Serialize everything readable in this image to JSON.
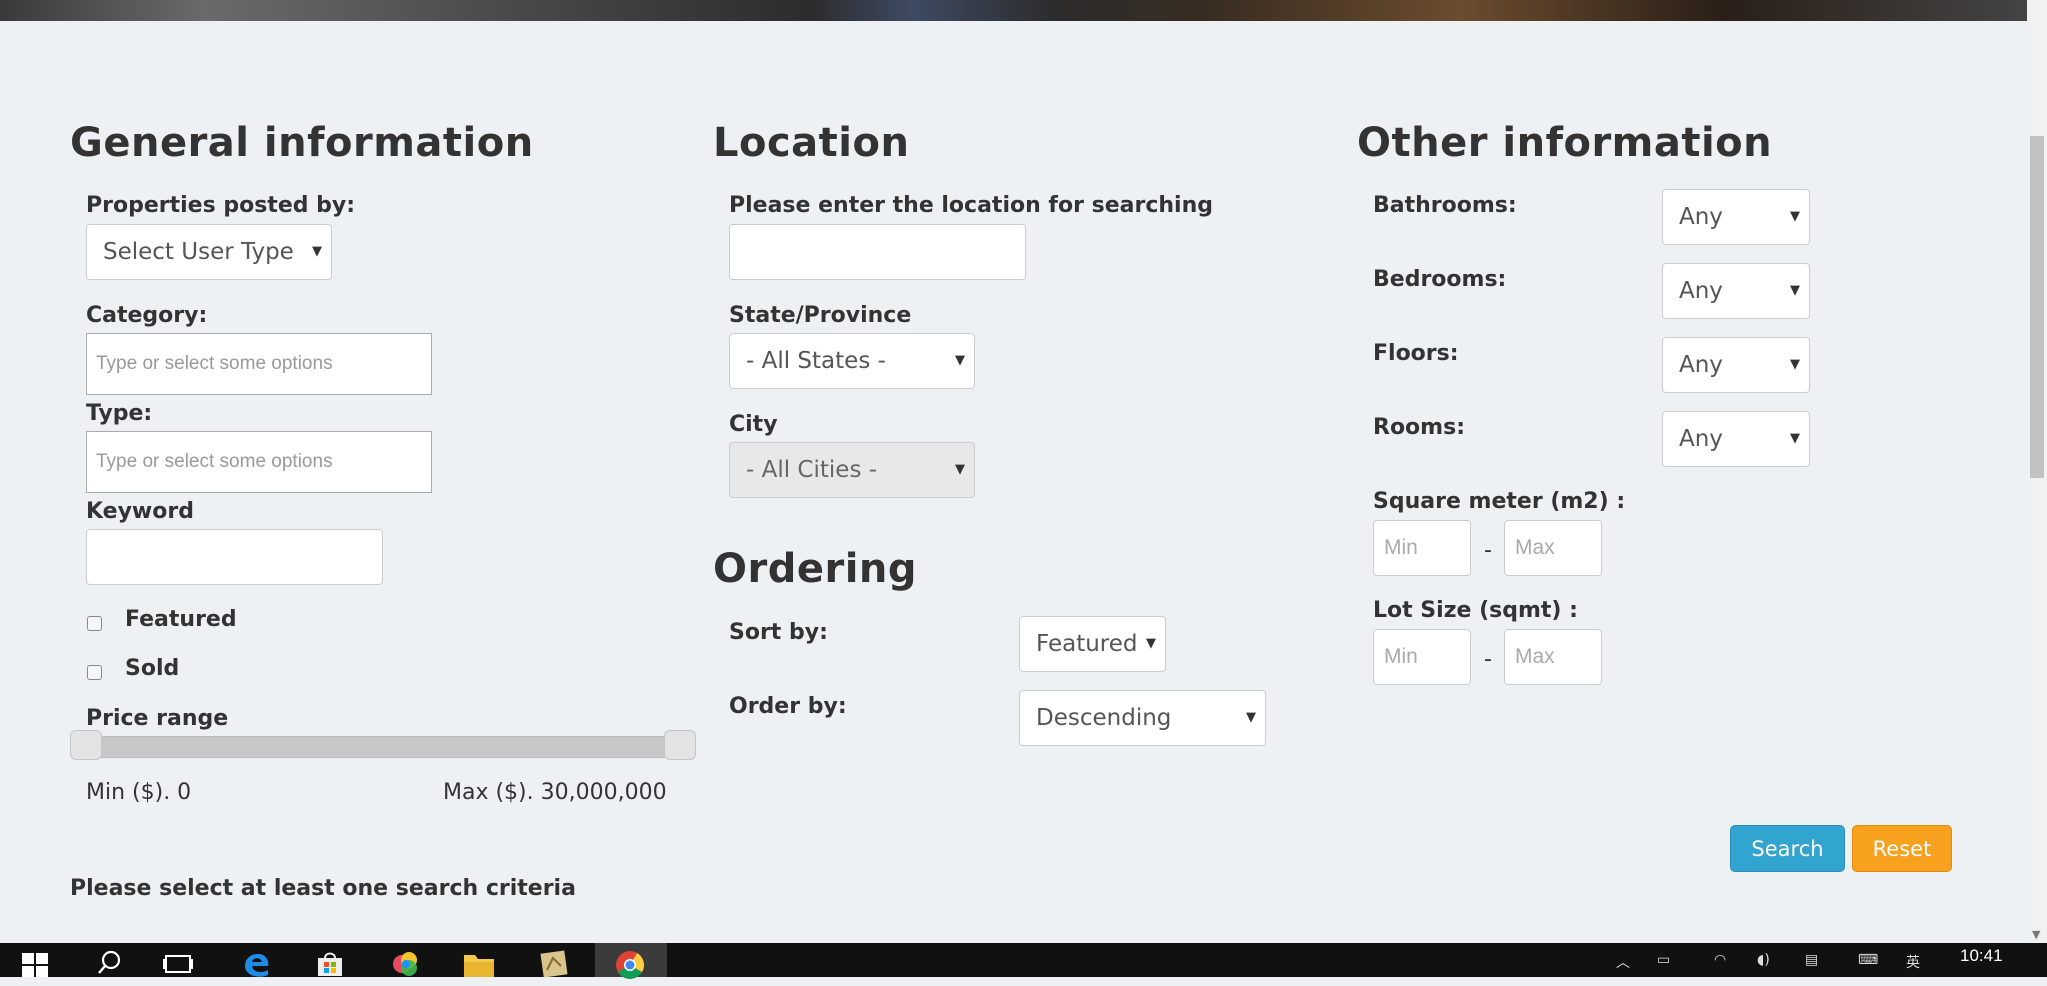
{
  "general": {
    "heading": "General information",
    "posted_by_label": "Properties posted by:",
    "posted_by_value": "Select User Type",
    "category_label": "Category:",
    "category_placeholder": "Type or select some options",
    "type_label": "Type:",
    "type_placeholder": "Type or select some options",
    "keyword_label": "Keyword",
    "keyword_value": "",
    "featured_label": "Featured",
    "sold_label": "Sold",
    "price_label": "Price range",
    "price_min": "Min ($). 0",
    "price_max": "Max ($). 30,000,000"
  },
  "location": {
    "heading": "Location",
    "prompt": "Please enter the location for searching",
    "location_value": "",
    "state_label": "State/Province",
    "state_value": "- All States -",
    "city_label": "City",
    "city_value": "- All Cities -"
  },
  "ordering": {
    "heading": "Ordering",
    "sort_label": "Sort by:",
    "sort_value": "Featured",
    "order_label": "Order by:",
    "order_value": "Descending"
  },
  "other": {
    "heading": "Other information",
    "bathrooms_label": "Bathrooms:",
    "bathrooms_value": "Any",
    "bedrooms_label": "Bedrooms:",
    "bedrooms_value": "Any",
    "floors_label": "Floors:",
    "floors_value": "Any",
    "rooms_label": "Rooms:",
    "rooms_value": "Any",
    "sqm_label": "Square meter (m2) :",
    "sqm_min_placeholder": "Min",
    "sqm_max_placeholder": "Max",
    "lot_label": "Lot Size (sqmt) :",
    "lot_min_placeholder": "Min",
    "lot_max_placeholder": "Max",
    "dash": "-"
  },
  "actions": {
    "search": "Search",
    "reset": "Reset"
  },
  "notice": "Please select at least one search criteria",
  "taskbar": {
    "time": "10:41",
    "ime": "英"
  },
  "colors": {
    "page_bg": "#eef1f4",
    "search_btn": "#31a4cf",
    "reset_btn": "#f7a11f"
  }
}
